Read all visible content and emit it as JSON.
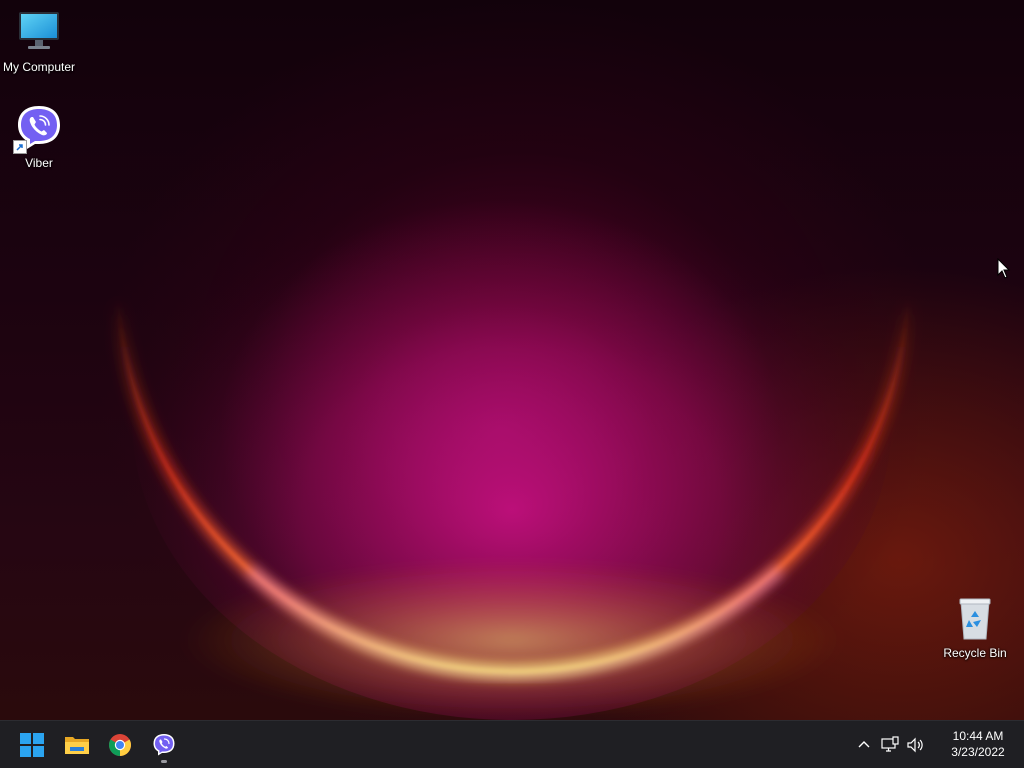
{
  "desktop": {
    "icons": [
      {
        "id": "my-computer",
        "label": "My Computer",
        "icon": "monitor-icon"
      },
      {
        "id": "viber",
        "label": "Viber",
        "icon": "viber-icon",
        "shortcut": true
      },
      {
        "id": "recycle-bin",
        "label": "Recycle Bin",
        "icon": "recycle-bin-icon"
      }
    ]
  },
  "taskbar": {
    "apps": [
      {
        "name": "Start",
        "icon": "windows-logo-icon"
      },
      {
        "name": "File Explorer",
        "icon": "folder-icon"
      },
      {
        "name": "Google Chrome",
        "icon": "chrome-icon"
      },
      {
        "name": "Viber",
        "icon": "viber-icon",
        "running": true
      }
    ],
    "tray": {
      "icons": [
        "chevron-up-icon",
        "network-icon",
        "volume-icon"
      ],
      "time": "10:44 AM",
      "date": "3/23/2022"
    }
  },
  "colors": {
    "taskbar_bg": "#1f1f23",
    "viber_purple": "#7360f2",
    "windows_blue": "#2ba4f0"
  }
}
